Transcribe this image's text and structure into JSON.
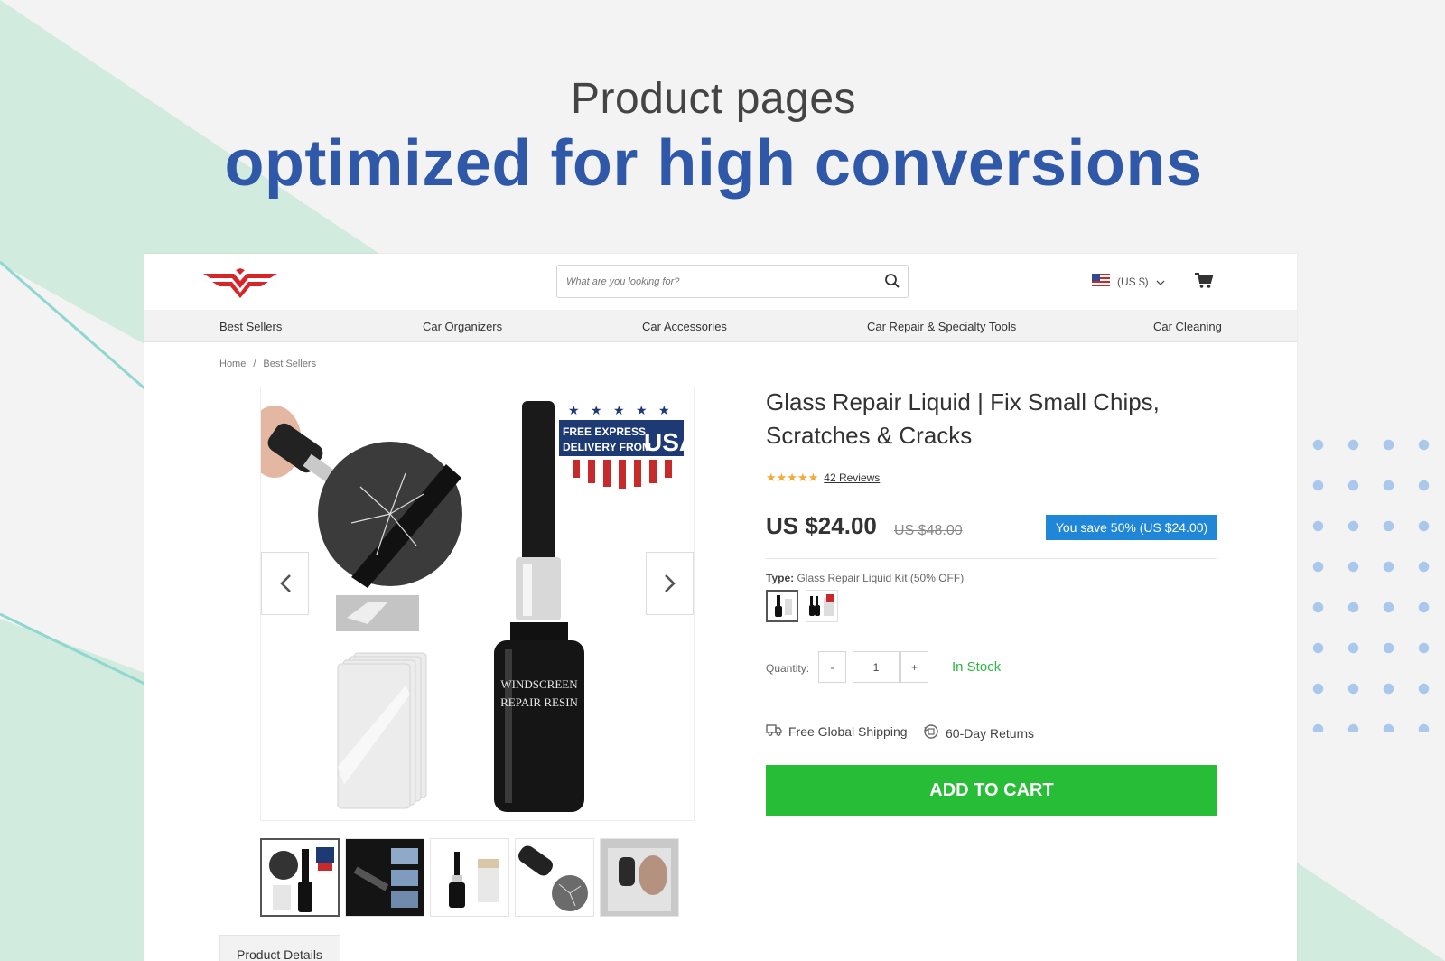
{
  "hero": {
    "line1": "Product pages",
    "line2": "optimized for high conversions"
  },
  "header": {
    "search_placeholder": "What are you looking for?",
    "currency": "(US $)"
  },
  "nav": {
    "items": [
      "Best Sellers",
      "Car Organizers",
      "Car Accessories",
      "Car Repair & Specialty Tools",
      "Car Cleaning"
    ]
  },
  "breadcrumb": {
    "home": "Home",
    "separator": "/",
    "current": "Best Sellers"
  },
  "product": {
    "title": "Glass Repair Liquid | Fix Small Chips, Scratches & Cracks",
    "stars": "★★★★★",
    "reviews": "42 Reviews",
    "price": "US $24.00",
    "old_price": "US $48.00",
    "save_badge": "You save 50% (US $24.00)",
    "type_label": "Type:",
    "type_value": "Glass Repair Liquid Kit (50% OFF)",
    "quantity_label": "Quantity:",
    "quantity_value": "1",
    "qty_minus": "-",
    "qty_plus": "+",
    "stock": "In Stock",
    "shipping": "Free Global Shipping",
    "returns": "60-Day Returns",
    "add_to_cart": "ADD TO CART",
    "image_banner_line1": "FREE EXPRESS",
    "image_banner_line2": "DELIVERY FROM",
    "image_banner_usa": "USA",
    "bottle_label_line1": "WINDSCREEN",
    "bottle_label_line2": "REPAIR RESIN"
  },
  "tabs": {
    "details": "Product Details"
  },
  "colors": {
    "brand_blue": "#2f58a8",
    "save_badge": "#1f86d8",
    "add_to_cart": "#27bd37",
    "in_stock": "#2db842",
    "stars": "#f4a93b",
    "logo_red": "#d8242b"
  }
}
